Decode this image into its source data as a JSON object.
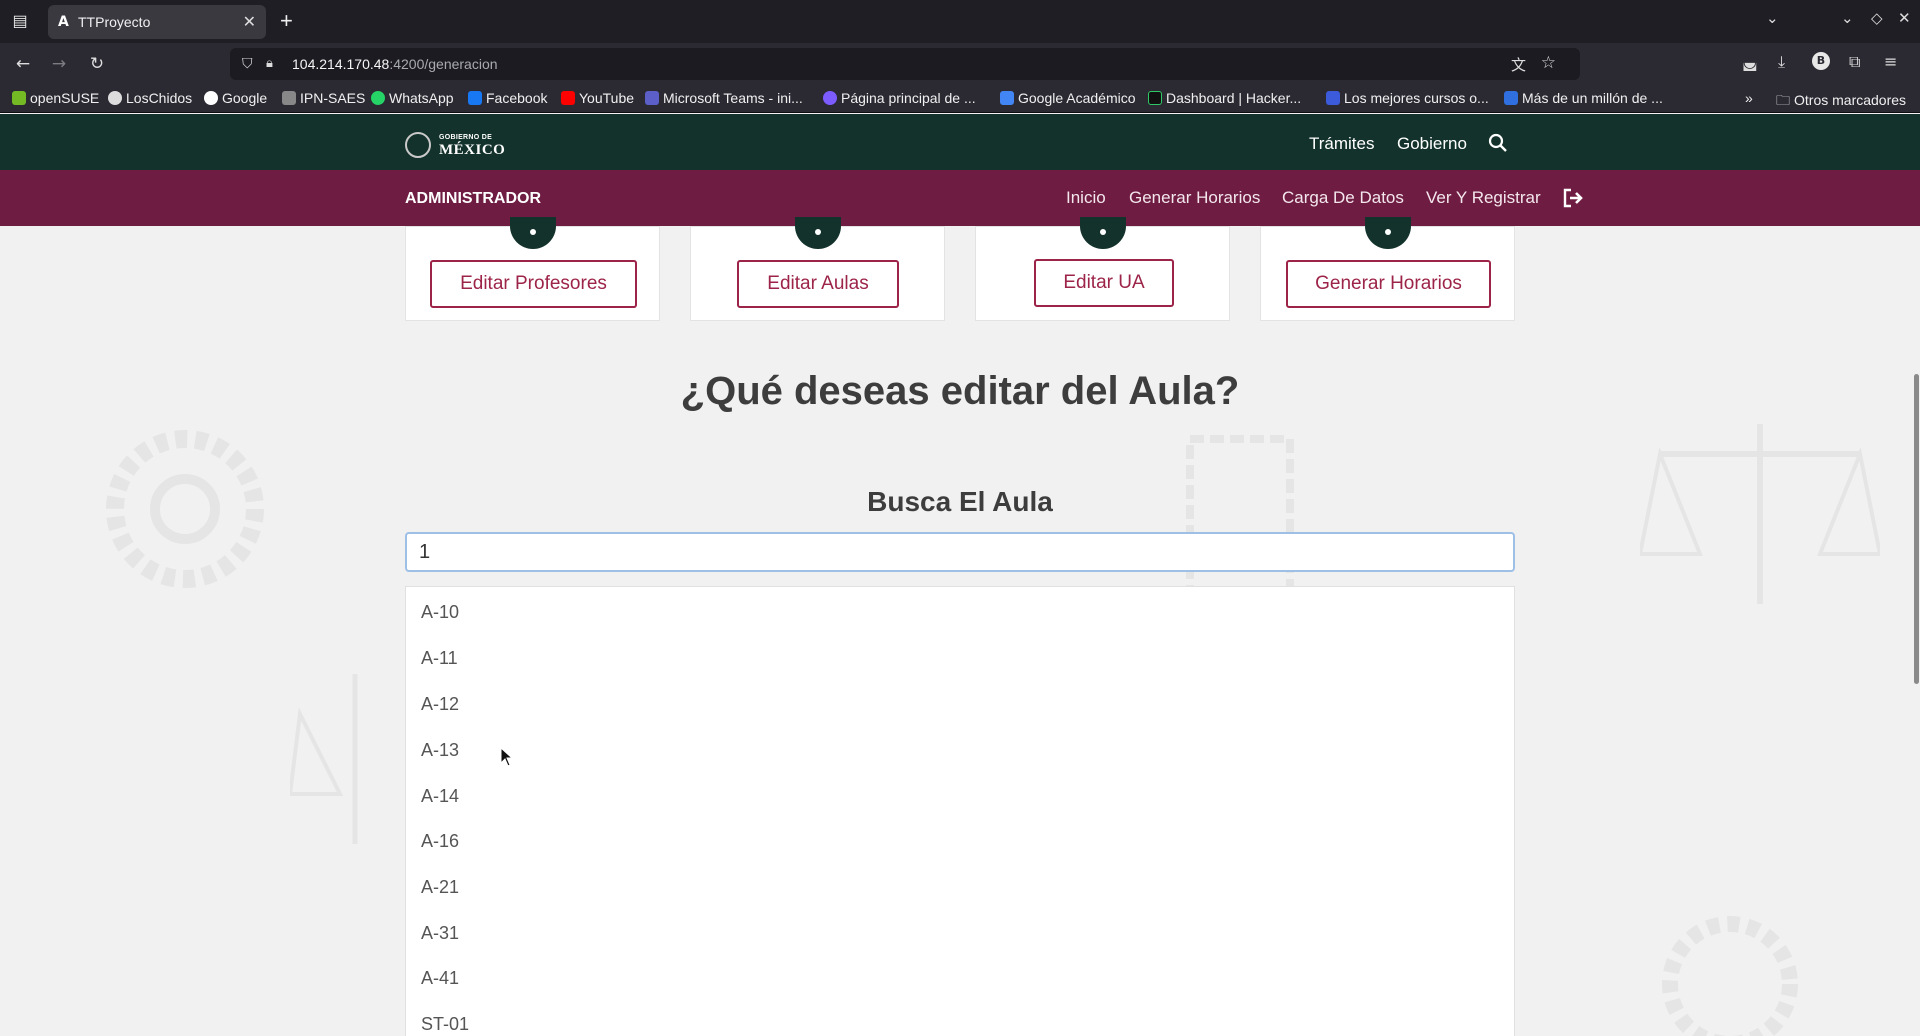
{
  "browser": {
    "tab_title": "TTProyecto",
    "tab_favicon": "A",
    "url_host": "104.214.170.48",
    "url_path": ":4200/generacion",
    "bookmarks": [
      "openSUSE",
      "LosChidos",
      "Google",
      "IPN-SAES",
      "WhatsApp",
      "Facebook",
      "YouTube",
      "Microsoft Teams - ini...",
      "Página principal de ...",
      "Google Académico",
      "Dashboard | Hacker...",
      "Los mejores cursos o...",
      "Más de un millón de ...",
      "Otros marcadores"
    ],
    "icons": {
      "tab_list": "tab-list-icon",
      "new_tab": "plus-icon",
      "back": "back-arrow-icon",
      "forward": "forward-arrow-icon",
      "reload": "reload-icon",
      "translate": "translate-icon",
      "bookmark": "star-icon",
      "pocket": "pocket-icon",
      "download": "download-icon",
      "extensions": "puzzle-icon",
      "menu": "hamburger-icon"
    }
  },
  "gob_header": {
    "logo_small": "GOBIERNO DE",
    "logo_big": "MÉXICO",
    "links": [
      "Trámites",
      "Gobierno"
    ]
  },
  "admin_bar": {
    "title": "ADMINISTRADOR",
    "links": [
      "Inicio",
      "Generar Horarios",
      "Carga De Datos",
      "Ver Y Registrar"
    ]
  },
  "cards": [
    {
      "button": "Editar Profesores"
    },
    {
      "button": "Editar Aulas"
    },
    {
      "button": "Editar UA"
    },
    {
      "button": "Generar Horarios"
    }
  ],
  "main": {
    "heading": "¿Qué deseas editar del Aula?",
    "subheading": "Busca El Aula",
    "search_value": "1",
    "results": [
      "A-10",
      "A-11",
      "A-12",
      "A-13",
      "A-14",
      "A-16",
      "A-21",
      "A-31",
      "A-41",
      "ST-01"
    ]
  },
  "colors": {
    "gob_green": "#13322b",
    "admin_maroon": "#6f1c43",
    "button_accent": "#9d2449"
  }
}
